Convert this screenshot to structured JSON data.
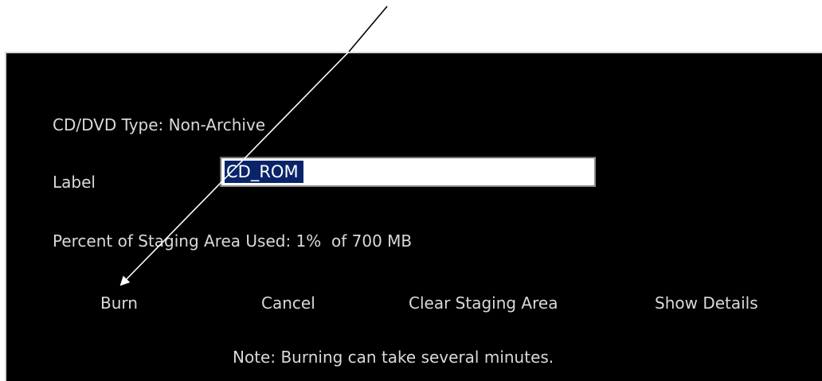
{
  "dialog": {
    "cd_type_label": "CD/DVD Type: Non-Archive",
    "label_caption": "Label",
    "label_value": "CD_ROM",
    "staging_text": "Percent of Staging Area Used: 1%  of 700 MB",
    "staging_percent_used": 1,
    "staging_capacity": "700 MB",
    "note": "Note: Burning can take several minutes."
  },
  "buttons": {
    "burn": "Burn",
    "cancel": "Cancel",
    "clear_staging": "Clear Staging Area",
    "show_details": "Show Details"
  },
  "annotation": {
    "arrow_target": "burn-button",
    "arrow_color": "#ffffff"
  },
  "colors": {
    "background": "#000000",
    "text": "#d9d9d9",
    "selection": "#0a246a",
    "page": "#ffffff"
  }
}
